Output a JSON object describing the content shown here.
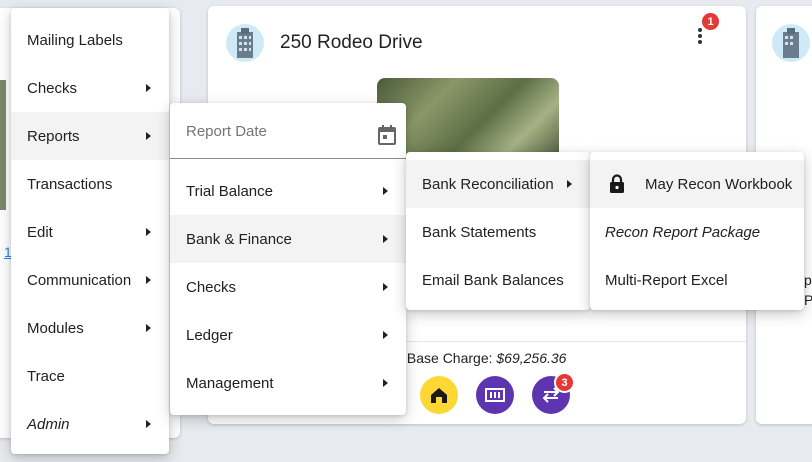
{
  "property_card": {
    "title": "250 Rodeo Drive",
    "notification_count": "1",
    "base_charge_label": "y Base Charge:",
    "base_charge_value": "$69,256.36",
    "transfer_badge_count": "3"
  },
  "left_card": {
    "link_fragment": "1"
  },
  "right_card": {
    "text_line1": "pe",
    "text_line2": "P"
  },
  "main_menu": {
    "items": [
      {
        "label": "Mailing Labels"
      },
      {
        "label": "Checks"
      },
      {
        "label": "Reports"
      },
      {
        "label": "Transactions"
      },
      {
        "label": "Edit"
      },
      {
        "label": "Communication"
      },
      {
        "label": "Modules"
      },
      {
        "label": "Trace"
      },
      {
        "label": "Admin"
      }
    ]
  },
  "reports_menu": {
    "report_date_placeholder": "Report Date",
    "items": [
      {
        "label": "Trial Balance"
      },
      {
        "label": "Bank & Finance"
      },
      {
        "label": "Checks"
      },
      {
        "label": "Ledger"
      },
      {
        "label": "Management"
      }
    ]
  },
  "bank_menu": {
    "items": [
      {
        "label": "Bank Reconciliation"
      },
      {
        "label": "Bank Statements"
      },
      {
        "label": "Email Bank Balances"
      }
    ]
  },
  "recon_menu": {
    "items": [
      {
        "label": "May Recon Workbook"
      },
      {
        "label": "Recon Report Package"
      },
      {
        "label": "Multi-Report Excel"
      }
    ]
  },
  "colors": {
    "accent_yellow": "#fdd835",
    "accent_purple": "#5e35b1",
    "badge_red": "#e53935",
    "highlight": "#f3f3f3"
  }
}
